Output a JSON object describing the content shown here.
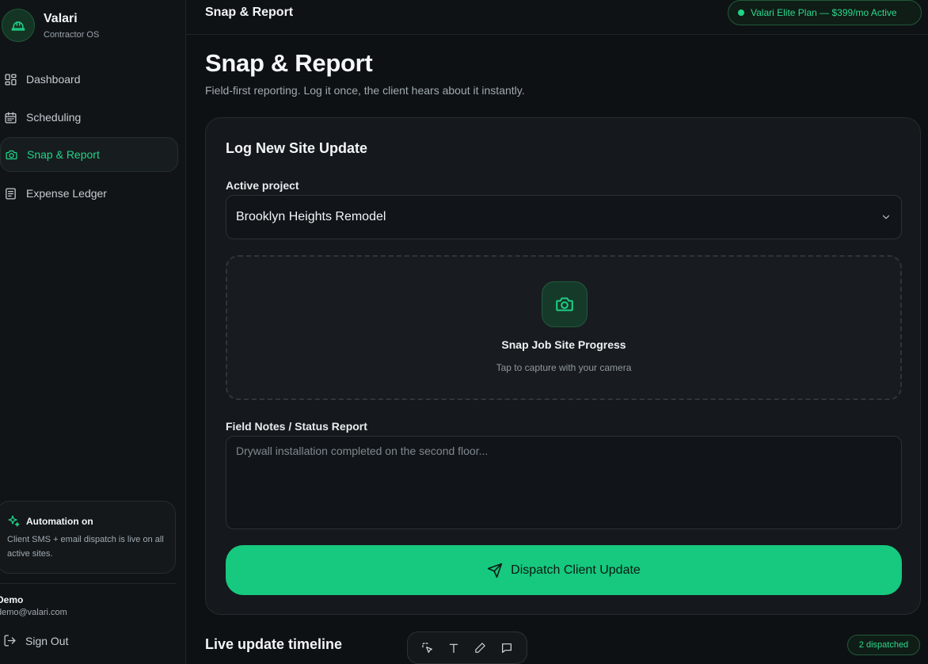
{
  "brand": {
    "name": "Valari",
    "subtitle": "Contractor OS"
  },
  "sidebar": {
    "items": [
      {
        "label": "Dashboard",
        "icon": "dashboard-icon",
        "active": false
      },
      {
        "label": "Scheduling",
        "icon": "calendar-icon",
        "active": false
      },
      {
        "label": "Snap & Report",
        "icon": "camera-icon",
        "active": true
      },
      {
        "label": "Expense Ledger",
        "icon": "ledger-icon",
        "active": false
      }
    ],
    "automation": {
      "title": "Automation on",
      "description": "Client SMS + email dispatch is live on all active sites."
    },
    "user": {
      "name": "Demo",
      "email": "demo@valari.com"
    },
    "signout_label": "Sign Out"
  },
  "topbar": {
    "title": "Snap & Report",
    "plan_badge": "Valari Elite Plan — $399/mo Active"
  },
  "main": {
    "title": "Snap & Report",
    "subtitle": "Field-first reporting. Log it once, the client hears about it instantly.",
    "card": {
      "title": "Log New Site Update",
      "project_label": "Active project",
      "project_value": "Brooklyn Heights Remodel",
      "upload_title": "Snap Job Site Progress",
      "upload_subtitle": "Tap to capture with your camera",
      "notes_label": "Field Notes / Status Report",
      "notes_placeholder": "Drywall installation completed on the second floor...",
      "dispatch_label": "Dispatch Client Update"
    },
    "timeline": {
      "title": "Live update timeline",
      "badge": "2 dispatched"
    }
  },
  "colors": {
    "accent": "#16c97f",
    "background": "#0e1114",
    "card": "#15181c"
  }
}
